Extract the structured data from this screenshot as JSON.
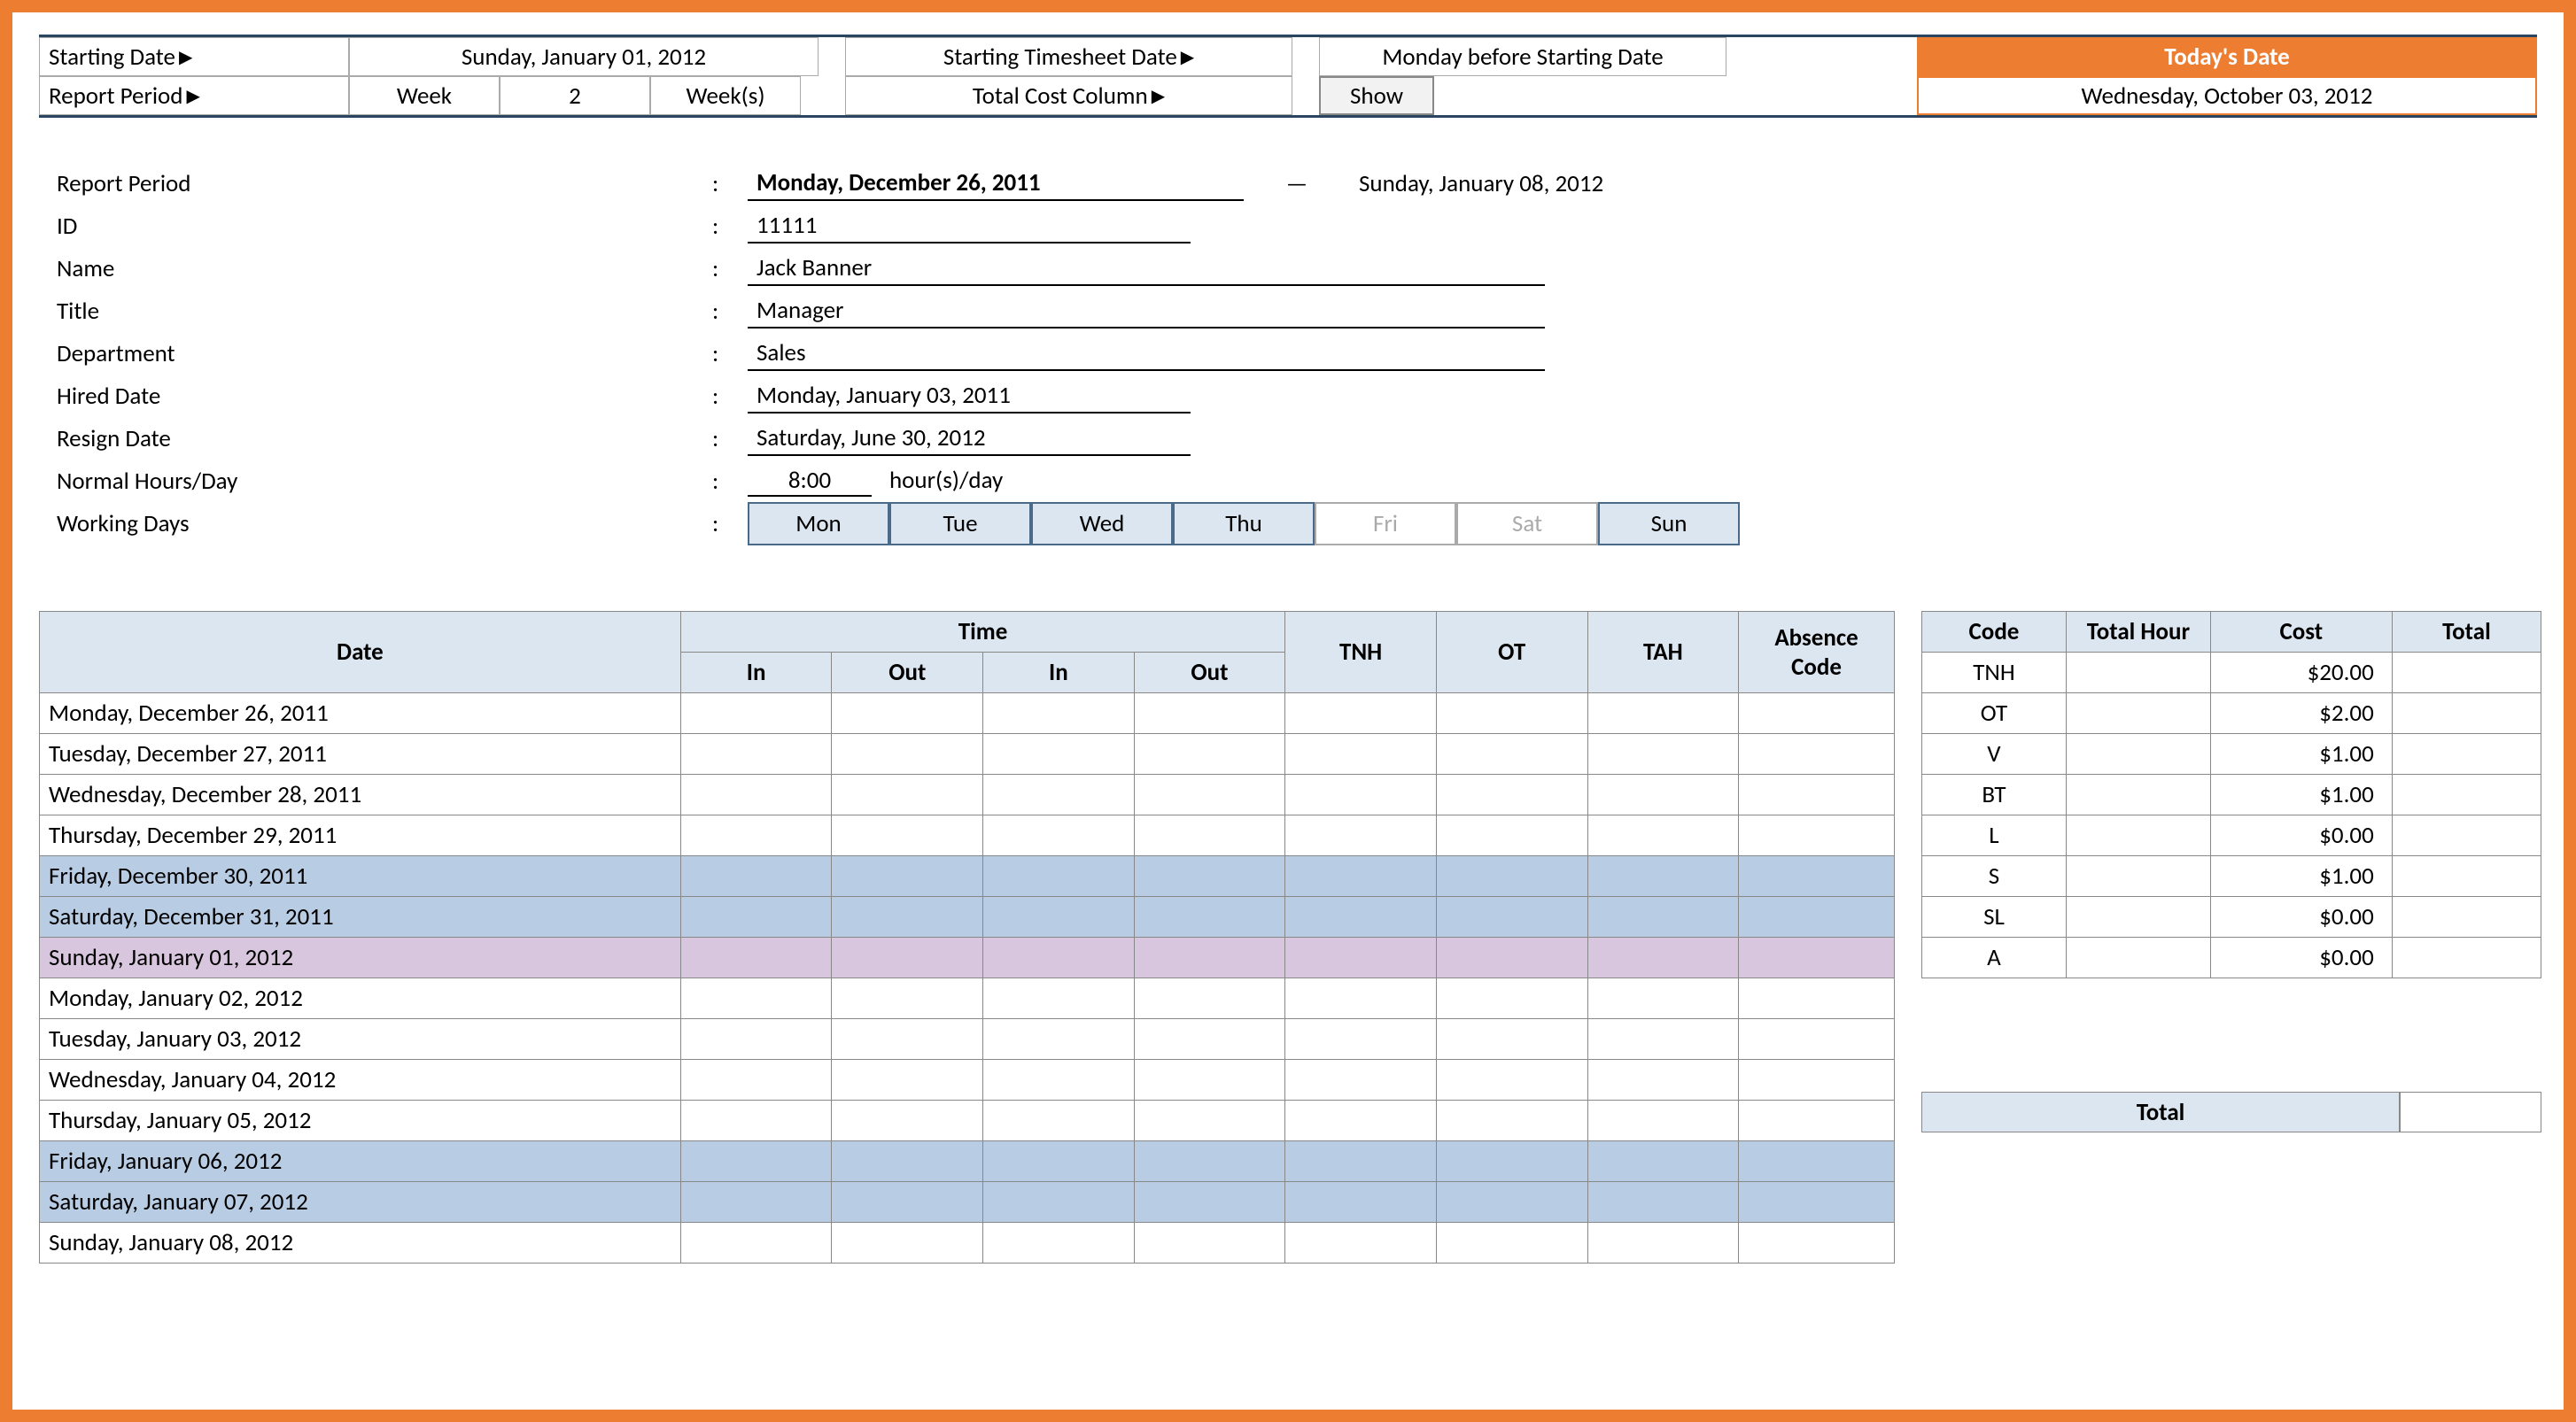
{
  "topbar": {
    "starting_date_label": "Starting Date",
    "starting_date_value": "Sunday, January 01, 2012",
    "starting_ts_label": "Starting Timesheet Date",
    "starting_ts_value": "Monday before Starting Date",
    "report_period_label": "Report Period",
    "report_period_unit": "Week",
    "report_period_num": "2",
    "report_period_suffix": "Week(s)",
    "total_cost_col_label": "Total Cost Column",
    "total_cost_col_value": "Show",
    "todays_date_label": "Today's Date",
    "todays_date_value": "Wednesday, October 03, 2012"
  },
  "info": {
    "report_period_label": "Report Period",
    "report_period_from": "Monday, December 26, 2011",
    "report_period_dash": "—",
    "report_period_to": "Sunday, January 08, 2012",
    "id_label": "ID",
    "id_value": "11111",
    "name_label": "Name",
    "name_value": "Jack Banner",
    "title_label": "Title",
    "title_value": "Manager",
    "department_label": "Department",
    "department_value": "Sales",
    "hired_label": "Hired Date",
    "hired_value": "Monday, January 03, 2011",
    "resign_label": "Resign Date",
    "resign_value": "Saturday, June 30, 2012",
    "hours_label": "Normal Hours/Day",
    "hours_value": "8:00",
    "hours_suffix": "hour(s)/day",
    "working_days_label": "Working Days",
    "days": [
      "Mon",
      "Tue",
      "Wed",
      "Thu",
      "Fri",
      "Sat",
      "Sun"
    ]
  },
  "timesheet": {
    "headers": {
      "date": "Date",
      "time": "Time",
      "in": "In",
      "out": "Out",
      "tnh": "TNH",
      "ot": "OT",
      "tah": "TAH",
      "absence": "Absence Code"
    },
    "rows": [
      {
        "date": "Monday, December 26, 2011",
        "cls": ""
      },
      {
        "date": "Tuesday, December 27, 2011",
        "cls": ""
      },
      {
        "date": "Wednesday, December 28, 2011",
        "cls": ""
      },
      {
        "date": "Thursday, December 29, 2011",
        "cls": ""
      },
      {
        "date": "Friday, December 30, 2011",
        "cls": "wknd"
      },
      {
        "date": "Saturday, December 31, 2011",
        "cls": "wknd"
      },
      {
        "date": "Sunday, January 01, 2012",
        "cls": "sun"
      },
      {
        "date": "Monday, January 02, 2012",
        "cls": ""
      },
      {
        "date": "Tuesday, January 03, 2012",
        "cls": ""
      },
      {
        "date": "Wednesday, January 04, 2012",
        "cls": ""
      },
      {
        "date": "Thursday, January 05, 2012",
        "cls": ""
      },
      {
        "date": "Friday, January 06, 2012",
        "cls": "wknd"
      },
      {
        "date": "Saturday, January 07, 2012",
        "cls": "wknd"
      },
      {
        "date": "Sunday, January 08, 2012",
        "cls": ""
      }
    ]
  },
  "cost_table": {
    "headers": {
      "code": "Code",
      "total_hour": "Total Hour",
      "cost": "Cost",
      "total": "Total"
    },
    "rows": [
      {
        "code": "TNH",
        "cost": "$20.00"
      },
      {
        "code": "OT",
        "cost": "$2.00"
      },
      {
        "code": "V",
        "cost": "$1.00"
      },
      {
        "code": "BT",
        "cost": "$1.00"
      },
      {
        "code": "L",
        "cost": "$0.00"
      },
      {
        "code": "S",
        "cost": "$1.00"
      },
      {
        "code": "SL",
        "cost": "$0.00"
      },
      {
        "code": "A",
        "cost": "$0.00"
      }
    ],
    "grand_total_label": "Total"
  }
}
